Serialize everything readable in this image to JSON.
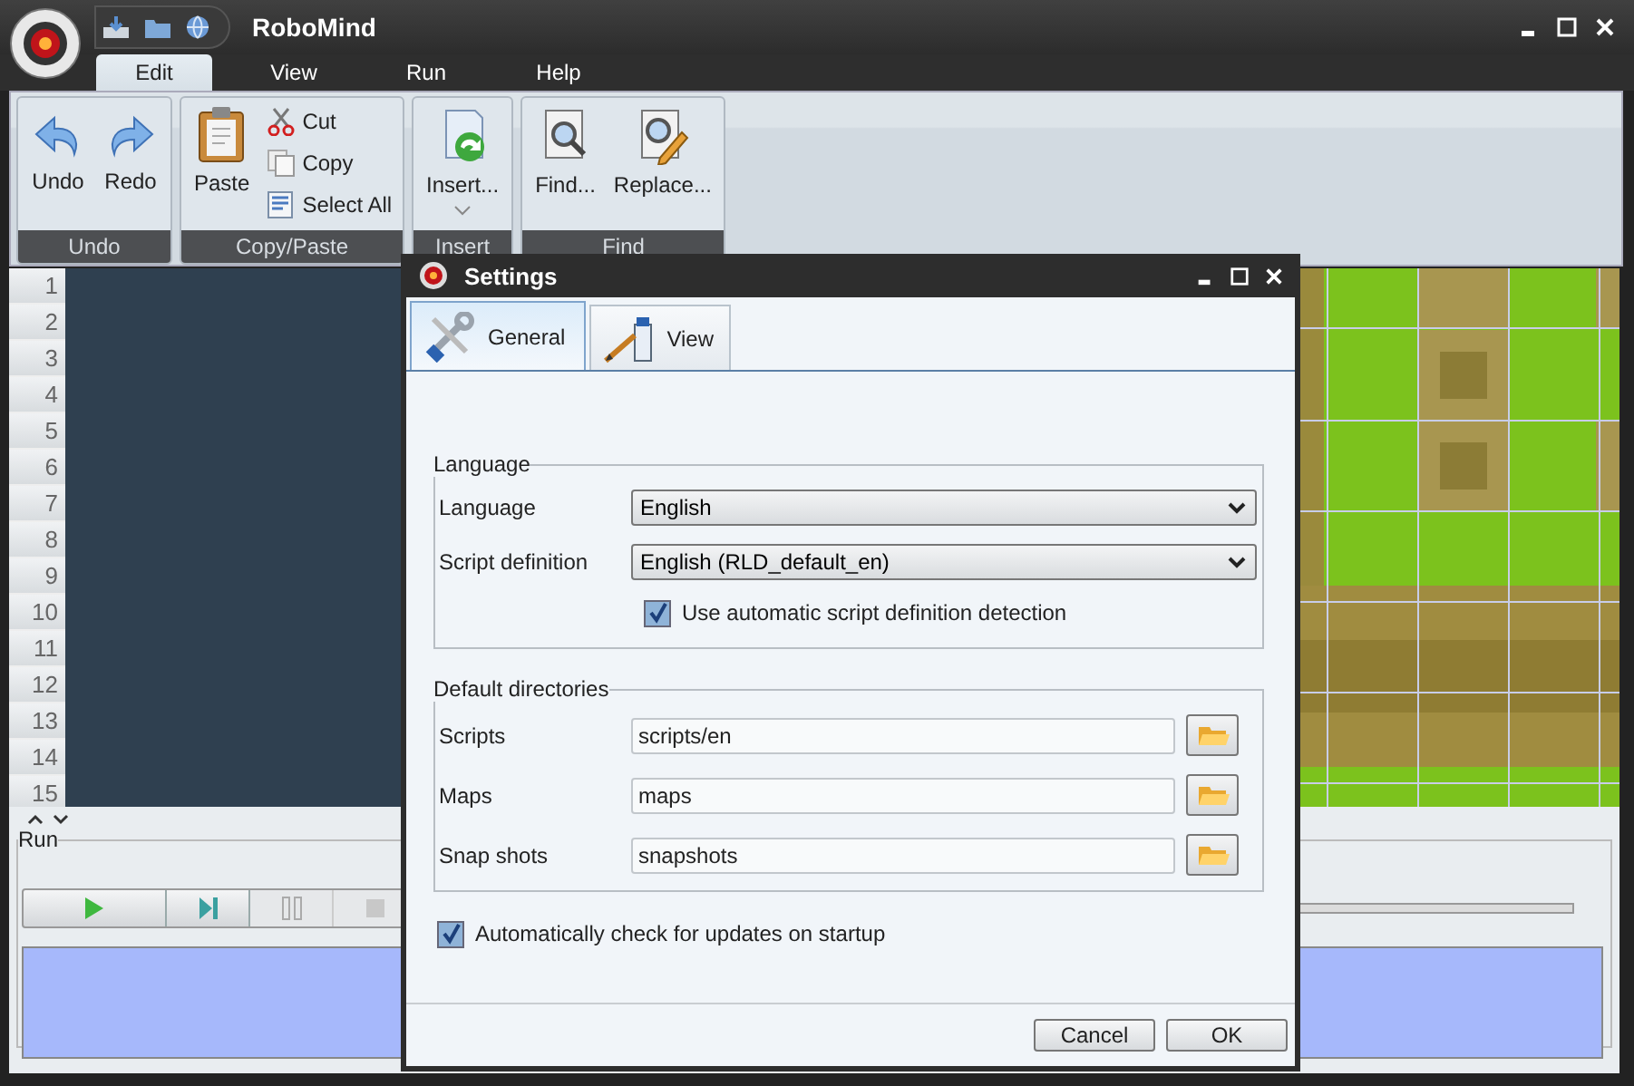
{
  "window": {
    "title": "RoboMind"
  },
  "menu_tabs": [
    {
      "label": "Edit",
      "selected": true
    },
    {
      "label": "View",
      "selected": false
    },
    {
      "label": "Run",
      "selected": false
    },
    {
      "label": "Help",
      "selected": false
    }
  ],
  "ribbon_groups": [
    {
      "label": "Undo",
      "items": [
        {
          "kind": "large",
          "label": "Undo"
        },
        {
          "kind": "large",
          "label": "Redo"
        }
      ]
    },
    {
      "label": "Copy/Paste",
      "items": [
        {
          "kind": "large",
          "label": "Paste"
        },
        {
          "kind": "small",
          "label": "Cut"
        },
        {
          "kind": "small",
          "label": "Copy"
        },
        {
          "kind": "small",
          "label": "Select All"
        }
      ]
    },
    {
      "label": "Insert",
      "items": [
        {
          "kind": "dropdown",
          "label": "Insert..."
        }
      ]
    },
    {
      "label": "Find",
      "items": [
        {
          "kind": "large",
          "label": "Find..."
        },
        {
          "kind": "large",
          "label": "Replace..."
        }
      ]
    }
  ],
  "line_numbers": [
    "1",
    "2",
    "3",
    "4",
    "5",
    "6",
    "7",
    "8",
    "9",
    "10",
    "11",
    "12",
    "13",
    "14",
    "15"
  ],
  "run_panel": {
    "title": "Run",
    "controls": [
      {
        "disabled": false
      },
      {
        "disabled": false
      },
      {
        "disabled": true
      },
      {
        "disabled": true
      }
    ]
  },
  "dialog": {
    "title": "Settings",
    "tabs": [
      {
        "label": "General",
        "selected": true
      },
      {
        "label": "View",
        "selected": false
      }
    ],
    "language_group": {
      "title": "Language",
      "fields": [
        {
          "label": "Language",
          "value": "English"
        },
        {
          "label": "Script definition",
          "value": "English (RLD_default_en)"
        }
      ],
      "auto_detect": {
        "label": "Use automatic script definition detection",
        "checked": true
      }
    },
    "directories_group": {
      "title": "Default directories",
      "fields": [
        {
          "label": "Scripts",
          "value": "scripts/en"
        },
        {
          "label": "Maps",
          "value": "maps"
        },
        {
          "label": "Snap shots",
          "value": "snapshots"
        }
      ]
    },
    "update_check": {
      "label": "Automatically check for updates on startup",
      "checked": true
    },
    "buttons": [
      "Cancel",
      "OK"
    ]
  }
}
